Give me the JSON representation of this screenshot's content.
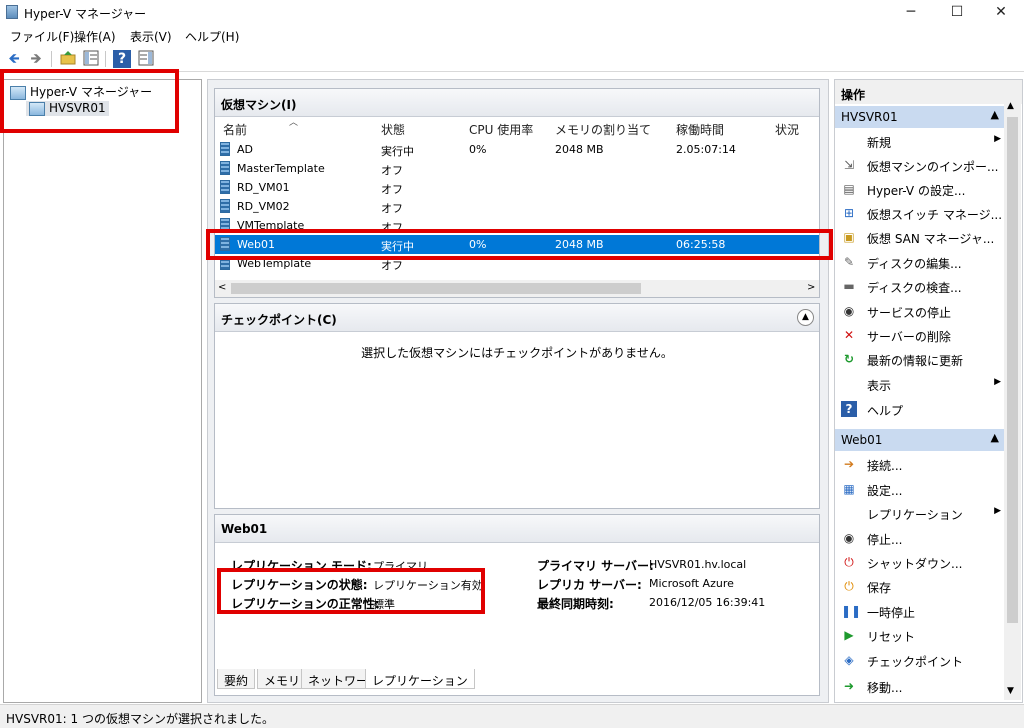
{
  "window": {
    "title": "Hyper-V マネージャー",
    "minimize": "─",
    "maximize": "☐",
    "close": "✕"
  },
  "menu": [
    "ファイル(F)",
    "操作(A)",
    "表示(V)",
    "ヘルプ(H)"
  ],
  "toolbar": {
    "back": "🡸",
    "forward": "🡺",
    "help": "?"
  },
  "tree": {
    "root": "Hyper-V マネージャー",
    "server": "HVSVR01"
  },
  "vms": {
    "header": "仮想マシン(I)",
    "columns": [
      "名前",
      "状態",
      "CPU 使用率",
      "メモリの割り当て",
      "稼働時間",
      "状況"
    ],
    "rows": [
      {
        "name": "AD",
        "state": "実行中",
        "cpu": "0%",
        "mem": "2048 MB",
        "uptime": "2.05:07:14"
      },
      {
        "name": "MasterTemplate",
        "state": "オフ",
        "cpu": "",
        "mem": "",
        "uptime": ""
      },
      {
        "name": "RD_VM01",
        "state": "オフ",
        "cpu": "",
        "mem": "",
        "uptime": ""
      },
      {
        "name": "RD_VM02",
        "state": "オフ",
        "cpu": "",
        "mem": "",
        "uptime": ""
      },
      {
        "name": "VMTemplate",
        "state": "オフ",
        "cpu": "",
        "mem": "",
        "uptime": ""
      },
      {
        "name": "Web01",
        "state": "実行中",
        "cpu": "0%",
        "mem": "2048 MB",
        "uptime": "06:25:58"
      },
      {
        "name": "WebTemplate",
        "state": "オフ",
        "cpu": "",
        "mem": "",
        "uptime": ""
      }
    ]
  },
  "checkpoints": {
    "header": "チェックポイント(C)",
    "empty_message": "選択した仮想マシンにはチェックポイントがありません。"
  },
  "details": {
    "header": "Web01",
    "left": [
      {
        "label": "レプリケーション モード:",
        "value": "プライマリ"
      },
      {
        "label": "レプリケーションの状態:",
        "value": "レプリケーション有効"
      },
      {
        "label": "レプリケーションの正常性:",
        "value": "標準"
      }
    ],
    "right": [
      {
        "label": "プライマリ サーバー:",
        "value": "HVSVR01.hv.local"
      },
      {
        "label": "レプリカ サーバー:",
        "value": "Microsoft Azure"
      },
      {
        "label": "最終同期時刻:",
        "value": "2016/12/05 16:39:41"
      }
    ],
    "tabs": [
      "要約",
      "メモリ",
      "ネットワーク",
      "レプリケーション"
    ]
  },
  "actions": {
    "title": "操作",
    "server_section": "HVSVR01",
    "server_items": [
      {
        "label": "新規",
        "icon": "",
        "submenu": true
      },
      {
        "label": "仮想マシンのインポー...",
        "icon": "import-icon"
      },
      {
        "label": "Hyper-V の設定...",
        "icon": "settings-page-icon"
      },
      {
        "label": "仮想スイッチ マネージ...",
        "icon": "switch-icon"
      },
      {
        "label": "仮想 SAN マネージャ...",
        "icon": "san-icon"
      },
      {
        "label": "ディスクの編集...",
        "icon": "disk-edit-icon"
      },
      {
        "label": "ディスクの検査...",
        "icon": "disk-inspect-icon"
      },
      {
        "label": "サービスの停止",
        "icon": "stop-icon"
      },
      {
        "label": "サーバーの削除",
        "icon": "delete-icon"
      },
      {
        "label": "最新の情報に更新",
        "icon": "refresh-icon"
      },
      {
        "label": "表示",
        "icon": "",
        "submenu": true
      },
      {
        "label": "ヘルプ",
        "icon": "help-icon"
      }
    ],
    "vm_section": "Web01",
    "vm_items": [
      {
        "label": "接続...",
        "icon": "connect-icon"
      },
      {
        "label": "設定...",
        "icon": "settings-icon"
      },
      {
        "label": "レプリケーション",
        "icon": "",
        "submenu": true
      },
      {
        "label": "停止...",
        "icon": "stop-icon"
      },
      {
        "label": "シャットダウン...",
        "icon": "shutdown-icon"
      },
      {
        "label": "保存",
        "icon": "save-icon"
      },
      {
        "label": "一時停止",
        "icon": "pause-icon"
      },
      {
        "label": "リセット",
        "icon": "reset-icon"
      },
      {
        "label": "チェックポイント",
        "icon": "checkpoint-icon"
      },
      {
        "label": "移動...",
        "icon": "move-icon"
      }
    ]
  },
  "status": "HVSVR01:  1 つの仮想マシンが選択されました。",
  "colors": {
    "selection": "#0078d7",
    "highlight_box": "#e00000",
    "section_header": "#c9daf0"
  }
}
